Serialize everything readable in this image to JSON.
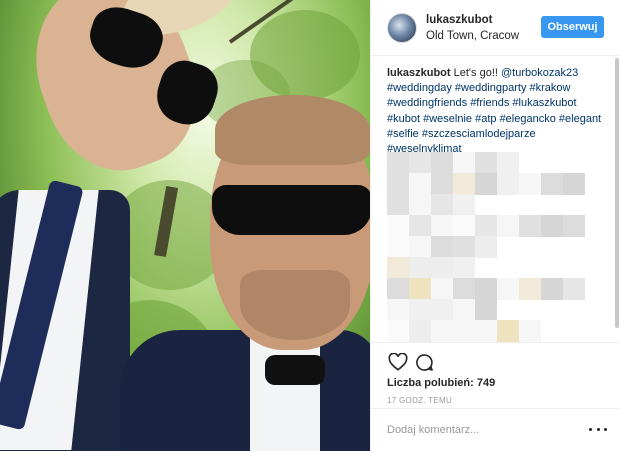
{
  "post": {
    "image": {
      "alt": "",
      "icon": "selfie-photo"
    },
    "author": {
      "username": "lukaszkubot",
      "location": "Old Town, Cracow",
      "follow_label": "Obserwuj"
    },
    "caption": {
      "username": "lukaszkubot",
      "text": "Let's go!!",
      "mention": "@turbokozak23",
      "hashtags": [
        "#weddingday",
        "#weddingparty",
        "#krakow",
        "#weddingfriends",
        "#friends",
        "#lukaszkubot",
        "#kubot",
        "#weselnie",
        "#atp",
        "#elegancko",
        "#elegant",
        "#selfie",
        "#szczesciamlodejparze",
        "#weselnyklimat"
      ]
    },
    "likes_text": "Liczba polubień: 749",
    "time_ago": "17 GODZ. TEMU",
    "comment_placeholder": "Dodaj komentarz...",
    "icons": {
      "like": "heart-icon",
      "comment": "comment-icon",
      "more": "more-options-icon"
    },
    "colors": {
      "follow_button": "#3897f0",
      "hashtag": "#003569"
    }
  }
}
